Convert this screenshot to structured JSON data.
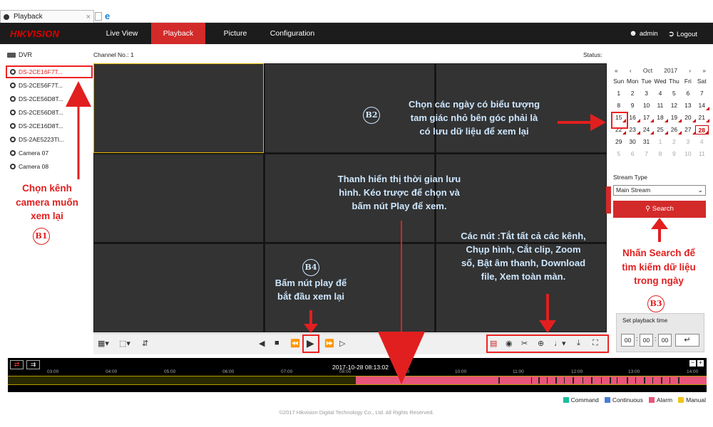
{
  "browser": {
    "tab_title": "Playback",
    "tab_close": "×"
  },
  "app": {
    "logo": "HIKVISION",
    "nav": [
      "Live View",
      "Playback",
      "Picture",
      "Configuration"
    ],
    "user": "admin",
    "logout": "Logout"
  },
  "left": {
    "root": "DVR",
    "channels": [
      "DS-2CE16F7T...",
      "DS-2CE56F7T...",
      "DS-2CE56D8T...",
      "DS-2CE56D8T...",
      "DS-2CE16D8T...",
      "DS-2AE5223TI...",
      "Camera 07",
      "Camera 08"
    ],
    "selected_index": 0
  },
  "main": {
    "channel_label": "Channel No.: 1",
    "status_label": "Status:"
  },
  "calendar": {
    "month": "Oct",
    "year": "2017",
    "weekdays": [
      "Sun",
      "Mon",
      "Tue",
      "Wed",
      "Thu",
      "Fri",
      "Sat"
    ],
    "days": [
      "1",
      "2",
      "3",
      "4",
      "5",
      "6",
      "7",
      "8",
      "9",
      "10",
      "11",
      "12",
      "13",
      "14",
      "15",
      "16",
      "17",
      "18",
      "19",
      "20",
      "21",
      "22",
      "23",
      "24",
      "25",
      "26",
      "27",
      "28",
      "29",
      "30",
      "31",
      "1",
      "2",
      "3",
      "4",
      "5",
      "6",
      "7",
      "8",
      "9",
      "10",
      "11"
    ],
    "recorded_days": [
      14,
      15,
      16,
      17,
      18,
      19,
      20,
      21,
      22,
      23,
      24,
      25,
      26,
      27,
      28
    ],
    "today": 28
  },
  "search": {
    "stream_type_label": "Stream Type",
    "stream_type_value": "Main Stream",
    "search_button": "Search"
  },
  "set_playback": {
    "label": "Set playback time",
    "hh": "00",
    "mm": "00",
    "ss": "00"
  },
  "timeline": {
    "current_time": "2017-10-28 08:13:02",
    "ticks": [
      "03:00",
      "04:00",
      "05:00",
      "06:00",
      "07:00",
      "08:00",
      "09:00",
      "10:00",
      "11:00",
      "12:00",
      "13:00",
      "14:00"
    ]
  },
  "legend": [
    {
      "label": "Command",
      "color": "#1abc9c"
    },
    {
      "label": "Continuous",
      "color": "#4a7bd8"
    },
    {
      "label": "Alarm",
      "color": "#e9557a"
    },
    {
      "label": "Manual",
      "color": "#f0c419"
    }
  ],
  "footer": "©2017 Hikvision Digital Technology Co., Ltd. All Rights Reserved.",
  "annotations": {
    "b1_text": [
      "Chọn kênh",
      "camera muốn",
      "xem lại"
    ],
    "b1_badge": "B1",
    "b2_text": [
      "Chọn các ngày có biểu tượng",
      "tam giác nhỏ bên góc phải là",
      "có lưu dữ liệu để xem lại"
    ],
    "b2_badge": "B2",
    "timeline_text": [
      "Thanh hiển thị thời gian lưu",
      "hình. Kéo trược để chọn và",
      "bấm nút Play để xem."
    ],
    "tools_text": [
      "Các nút :Tắt tất cả các kênh,",
      "Chụp hình, Cắt clip, Zoom",
      "số, Bật âm thanh, Download",
      "file, Xem toàn màn."
    ],
    "b4_text": [
      "Bấm nút play để",
      "bắt đầu xem lại"
    ],
    "b4_badge": "B4",
    "b3_text": [
      "Nhấn Search để",
      "tìm kiếm dữ liệu",
      "trong ngày"
    ],
    "b3_badge": "B3"
  }
}
